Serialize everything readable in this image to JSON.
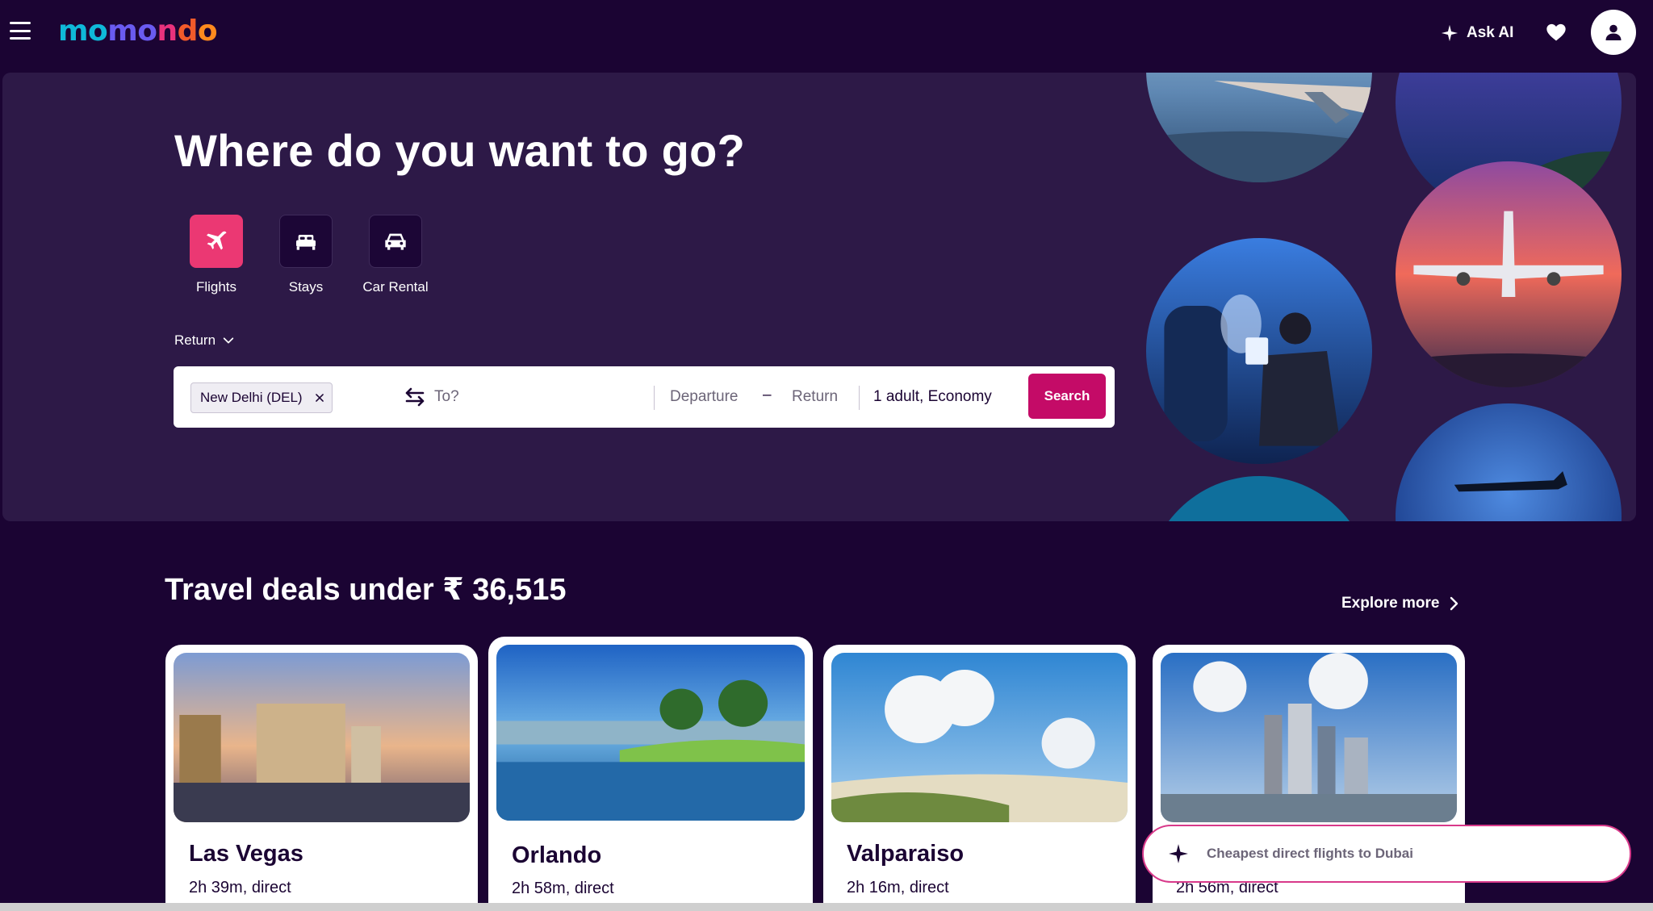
{
  "header": {
    "logo": [
      "mo",
      "mo",
      "n",
      "d",
      "o"
    ],
    "menu_icon": "hamburger-menu-icon",
    "ask_ai_label": "Ask AI",
    "ask_ai_icon": "sparkle-icon",
    "favorites_icon": "heart-icon",
    "account_icon": "user-avatar-icon"
  },
  "hero": {
    "title": "Where do you want to go?",
    "verticals": [
      {
        "label": "Flights",
        "icon": "plane-icon",
        "active": true
      },
      {
        "label": "Stays",
        "icon": "bed-icon",
        "active": false
      },
      {
        "label": "Car Rental",
        "icon": "car-icon",
        "active": false
      }
    ],
    "trip_type": "Return",
    "search": {
      "origin": "New Delhi (DEL)",
      "destination_placeholder": "To?",
      "departure_placeholder": "Departure",
      "date_separator": "–",
      "return_placeholder": "Return",
      "travellers": "1 adult, Economy",
      "search_label": "Search"
    }
  },
  "deals": {
    "title": "Travel deals under ₹ 36,515",
    "explore_label": "Explore more",
    "cards": [
      {
        "city": "Las Vegas",
        "duration": "2h 39m, direct"
      },
      {
        "city": "Orlando",
        "duration": "2h 58m, direct"
      },
      {
        "city": "Valparaiso",
        "duration": "2h 16m, direct"
      },
      {
        "city": "",
        "duration": "2h 56m, direct"
      }
    ]
  },
  "ai_prompt": {
    "text": "Cheapest direct flights to Dubai"
  },
  "colors": {
    "background": "#1b0433",
    "hero_panel": "#2d1947",
    "accent_pink": "#eb3873",
    "search_button": "#c40b67"
  }
}
